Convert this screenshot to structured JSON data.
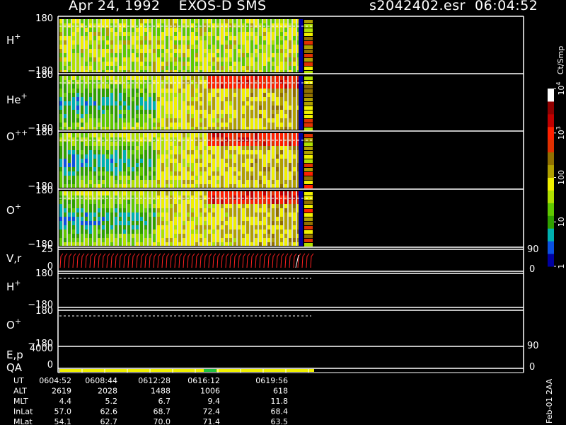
{
  "header": {
    "title_left": "Apr 24, 1992    EXOS-D SMS",
    "title_right": "s2042402.esr  06:04:52"
  },
  "chart_data": {
    "type": "heatmap",
    "panels": [
      {
        "label": "H",
        "charge": "+",
        "ymin": -180,
        "ymax": 180
      },
      {
        "label": "He",
        "charge": "+",
        "ymin": -180,
        "ymax": 180
      },
      {
        "label": "O",
        "charge": "++",
        "ymin": -180,
        "ymax": 180
      },
      {
        "label": "O",
        "charge": "+",
        "ymin": -180,
        "ymax": 180
      }
    ],
    "vr_panel": {
      "label": "V,r",
      "left_ticks": [
        "25",
        "0"
      ],
      "right_ticks": [
        "90",
        "0"
      ]
    },
    "h_plus_panel": {
      "label": "H",
      "charge": "+",
      "ymin": -180,
      "ymax": 180
    },
    "o_plus_panel": {
      "label": "O",
      "charge": "+",
      "ymin": -180,
      "ymax": 180
    },
    "ep_panel": {
      "label": "E,p",
      "left_tick": "4000",
      "right_ticks": [
        "90",
        "0"
      ]
    },
    "qa_panel": {
      "label": "QA",
      "left_tick": "0"
    },
    "colorbar": {
      "unit_label": "Ct/Smp",
      "tick_labels": [
        "1",
        "10",
        "100",
        "10",
        "10"
      ],
      "tick_exponents": [
        "",
        "",
        "",
        "3",
        "4"
      ],
      "min": 1,
      "max": 10000,
      "scale": "log",
      "colors": [
        "#0000a0",
        "#0a50e0",
        "#00b0b0",
        "#30a000",
        "#60c800",
        "#b0e000",
        "#f0f000",
        "#b0a000",
        "#907000",
        "#e03000",
        "#ff2000",
        "#c00000",
        "#900000",
        "#ffffff"
      ]
    },
    "times": [
      "0604:52",
      "0608:44",
      "0612:28",
      "0616:12",
      "0619:56"
    ],
    "ephemeris": [
      {
        "label": "UT",
        "values": [
          "0604:52",
          "0608:44",
          "0612:28",
          "0616:12",
          "0619:56"
        ]
      },
      {
        "label": "ALT",
        "values": [
          "2619",
          "2028",
          "1488",
          "1006",
          "618"
        ]
      },
      {
        "label": "MLT",
        "values": [
          "4.4",
          "5.2",
          "6.7",
          "9.4",
          "11.8"
        ]
      },
      {
        "label": "InLat",
        "values": [
          "57.0",
          "62.6",
          "68.7",
          "72.4",
          "68.4"
        ]
      },
      {
        "label": "MLat",
        "values": [
          "54.1",
          "62.7",
          "70.0",
          "71.4",
          "63.5"
        ]
      }
    ],
    "footer_label": "Feb-01 2AA"
  }
}
